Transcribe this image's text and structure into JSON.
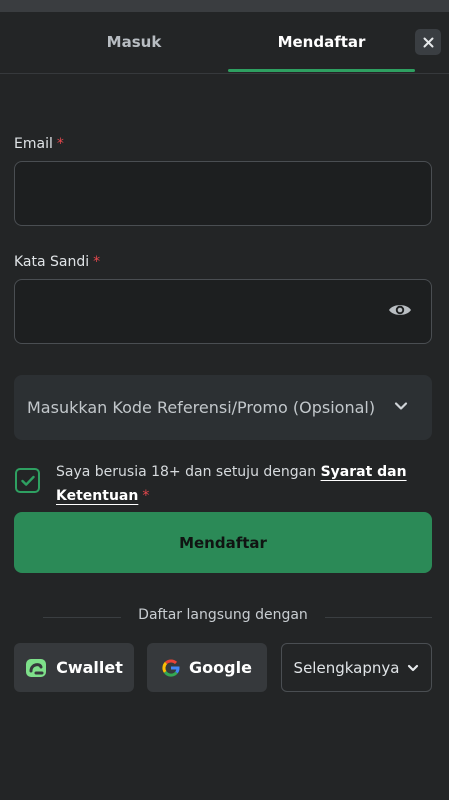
{
  "tabs": {
    "login_label": "Masuk",
    "register_label": "Mendaftar",
    "active": "register"
  },
  "form": {
    "email": {
      "label": "Email",
      "required_mark": "*",
      "value": ""
    },
    "password": {
      "label": "Kata Sandi",
      "required_mark": "*",
      "value": ""
    },
    "promo": {
      "label": "Masukkan Kode Referensi/Promo (Opsional)"
    },
    "consent": {
      "checked": true,
      "text": "Saya berusia 18+ dan setuju dengan",
      "link_text": "Syarat dan Ketentuan",
      "required_mark": "*"
    },
    "submit_label": "Mendaftar"
  },
  "social": {
    "divider_text": "Daftar langsung dengan",
    "cwallet_label": "Cwallet",
    "google_label": "Google",
    "more_label": "Selengkapnya"
  },
  "icons": {
    "close": "close-icon",
    "password_toggle": "eye-icon",
    "promo_expand": "chevron-down-icon",
    "checkbox": "check-icon",
    "cwallet": "cwallet-logo-icon",
    "google": "google-logo-icon",
    "more": "chevron-down-icon"
  },
  "colors": {
    "accent": "#2ea061",
    "submit_bg": "#2b8a57",
    "background": "#232526",
    "required": "#e5484d"
  }
}
